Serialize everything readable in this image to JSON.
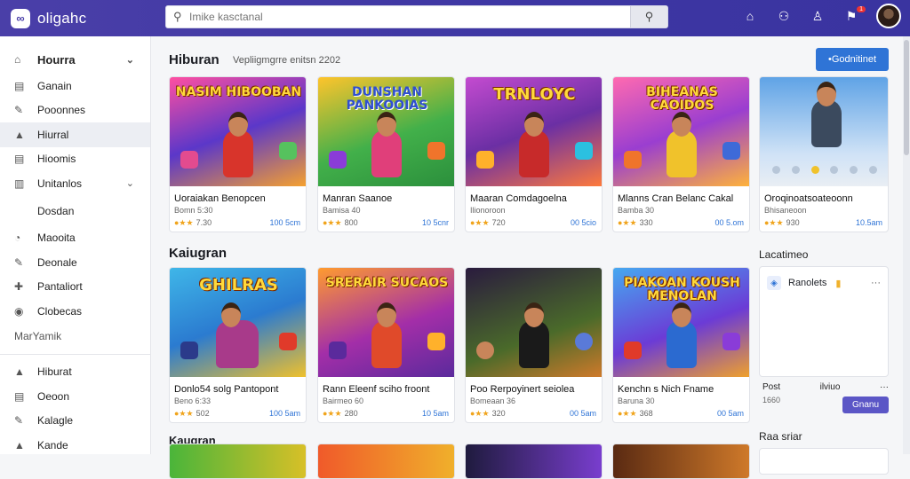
{
  "app": {
    "name": "oligahc",
    "logo_mark": "∞"
  },
  "search": {
    "placeholder": "Imike kasctanal"
  },
  "topbar": {
    "icons": [
      "store-icon",
      "gamepad-icon",
      "user-icon",
      "notifications-icon"
    ],
    "notification_count": "1"
  },
  "sidebar": {
    "group1_head": "Hourra",
    "items1": [
      {
        "label": "Ganain",
        "icon": "▤"
      },
      {
        "label": "Pooonnes",
        "icon": "✎"
      },
      {
        "label": "Hiurral",
        "icon": "▲"
      },
      {
        "label": "Hioomis",
        "icon": "▤"
      },
      {
        "label": "Unitanlos",
        "icon": "▥"
      }
    ],
    "sub_item": "Dosdan",
    "items2": [
      {
        "label": "Maooita",
        "icon": "◔"
      },
      {
        "label": "Deonale",
        "icon": "✎"
      },
      {
        "label": "Pantaliort",
        "icon": "✚"
      },
      {
        "label": "Clobecas",
        "icon": "◉"
      }
    ],
    "section_label": "MarYamik",
    "items3": [
      {
        "label": "Hiburat",
        "icon": "▲"
      },
      {
        "label": "Oeoon",
        "icon": "▤"
      },
      {
        "label": "Kalagle",
        "icon": "✎"
      },
      {
        "label": "Kande",
        "icon": "▲"
      }
    ]
  },
  "main": {
    "section1_title": "Hiburan",
    "section1_sub": "Vepliigmgrre enitsn 2202",
    "cta_label": "•Godnitinet",
    "section2_title": "Kaiugran",
    "section3_title": "Kaugran",
    "side_title": "Lacatimeo",
    "side_title2": "Raa sriar"
  },
  "row1": [
    {
      "art": "NASIM HIBOOBAN",
      "title": "Uoraiakan Benopcen",
      "meta": "Bomn 5:30",
      "rating": "7.30",
      "price": "100 5cm"
    },
    {
      "art": "DUNSHAN PANKOOIAS",
      "title": "Manran Saanoe",
      "meta": "Bamisa 40",
      "rating": "800",
      "price": "10 5cnr"
    },
    {
      "art": "TRNLOYC",
      "title": "Maaran Comdagoelna",
      "meta": "Ilionoroon",
      "rating": "720",
      "price": "00 5cio"
    },
    {
      "art": "BIHEANAS CAOIDOS",
      "title": "Mlanns Cran Belanc Cakal",
      "meta": "Bamba 30",
      "rating": "330",
      "price": "00 5.om"
    },
    {
      "art": "",
      "title": "Oroqinoatsoateoonn",
      "meta": "Bhisaneoon",
      "rating": "930",
      "price": "10.5am"
    }
  ],
  "row2": [
    {
      "art": "GHILRAS",
      "title": "Donlo54 solg Pantopont",
      "meta": "Beno 6:33",
      "rating": "502",
      "price": "100 5am"
    },
    {
      "art": "SRERAIR SUCAOS",
      "title": "Rann Eleenf sciho froont",
      "meta": "Bairmeo 60",
      "rating": "280",
      "price": "10 5am"
    },
    {
      "art": "",
      "title": "Poo Rerpoyinert seiolea",
      "meta": "Bomeaan 36",
      "rating": "320",
      "price": "00 5am"
    },
    {
      "art": "PIAKOAN KOUSH MENOLAN",
      "title": "Kenchn s Nich Fname",
      "meta": "Baruna 30",
      "rating": "368",
      "price": "00 5am"
    }
  ],
  "row3_count": 4,
  "panel": {
    "row_label": "Ranolets",
    "post_label": "Post",
    "post_value": "ilviuo",
    "post_meta": "1660",
    "post_button": "Gnanu"
  }
}
